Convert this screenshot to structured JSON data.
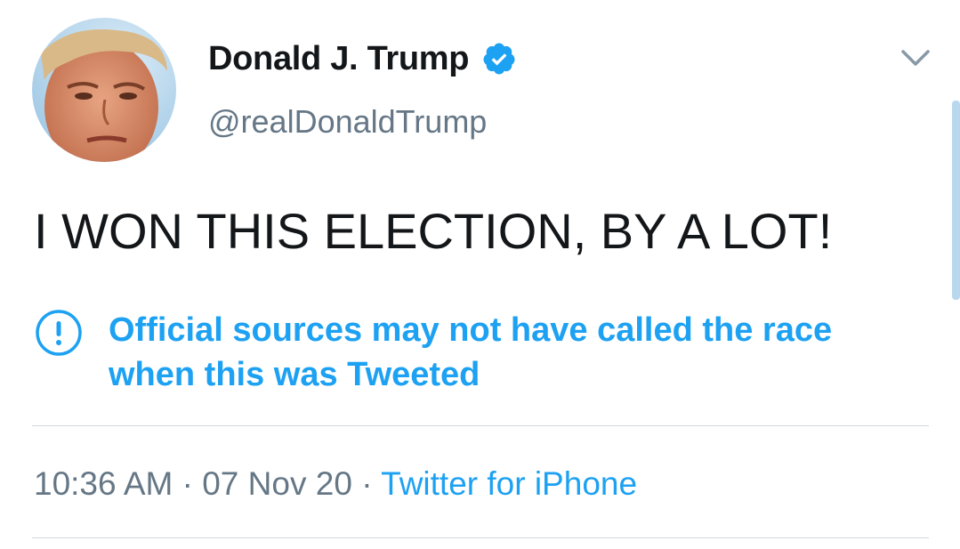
{
  "author": {
    "display_name": "Donald J. Trump",
    "handle": "@realDonaldTrump",
    "verified": true,
    "avatar_icon": "profile-photo"
  },
  "tweet": {
    "text": "I WON THIS ELECTION, BY A LOT!"
  },
  "notice": {
    "icon": "exclamation-circle-icon",
    "line1": "Official sources may not have called the race",
    "line2": "when this was Tweeted"
  },
  "meta": {
    "time": "10:36 AM",
    "separator": "·",
    "date": "07 Nov 20",
    "source": "Twitter for iPhone"
  },
  "colors": {
    "accent": "#1da1f2",
    "text_primary": "#14171a",
    "text_secondary": "#657786",
    "divider": "#cfd9de"
  }
}
